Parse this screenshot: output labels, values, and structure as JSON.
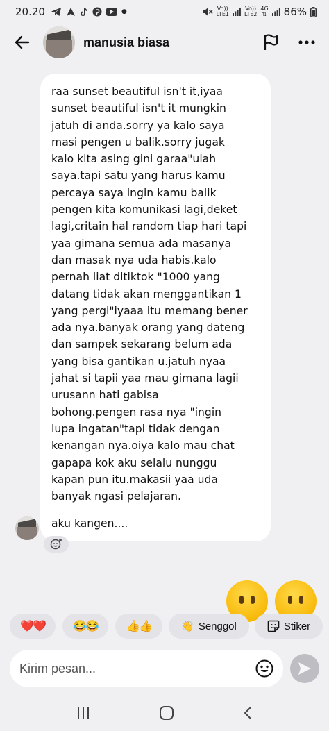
{
  "status_bar": {
    "time": "20.20",
    "net1_top": "Vo))",
    "net1_bottom": "LTE1",
    "net2_top": "Vo))",
    "net2_bottom": "LTE2",
    "net3_top": "4G",
    "battery": "86%"
  },
  "header": {
    "contact_name": "manusia biasa"
  },
  "message": {
    "body": "raa sunset beautiful isn't it,iyaa\nsunset beautiful isn't it mungkin\njatuh di anda.sorry ya kalo saya\nmasi pengen u balik.sorry jugak\nkalo kita asing gini garaa\"ulah\nsaya.tapi satu yang harus kamu\npercaya saya ingin kamu balik\npengen kita komunikasi lagi,deket\nlagi,critain hal random tiap hari tapi\nyaa gimana semua ada masanya\ndan masak nya uda habis.kalo\npernah liat ditiktok \"1000 yang\ndatang tidak akan menggantikan 1\nyang pergi\"iyaaa itu memang bener\nada nya.banyak orang yang dateng\ndan sampek sekarang belum ada\nyang bisa gantikan u.jatuh nyaa\njahat si tapii yaa mau gimana lagii\nurusann hati gabisa\nbohong.pengen rasa nya \"ingin\nlupa ingatan\"tapi tidak dengan\nkenangan nya.oiya kalo mau chat\ngapapa kok aku selalu nunggu\nkapan pun itu.makasii yaa uda\nbanyak ngasi pelajaran.",
    "closing": "aku kangen...."
  },
  "quick_replies": {
    "hearts": "❤️❤️",
    "laugh": "😂😂",
    "thumbs": "👍👍",
    "senggol_icon": "👋",
    "senggol_label": "Senggol",
    "stiker_label": "Stiker"
  },
  "composer": {
    "placeholder": "Kirim pesan..."
  },
  "colors": {
    "background": "#f0f0f3",
    "bubble": "#ffffff",
    "chip": "#e3e3e8",
    "send_disabled": "#bdbdc3"
  }
}
